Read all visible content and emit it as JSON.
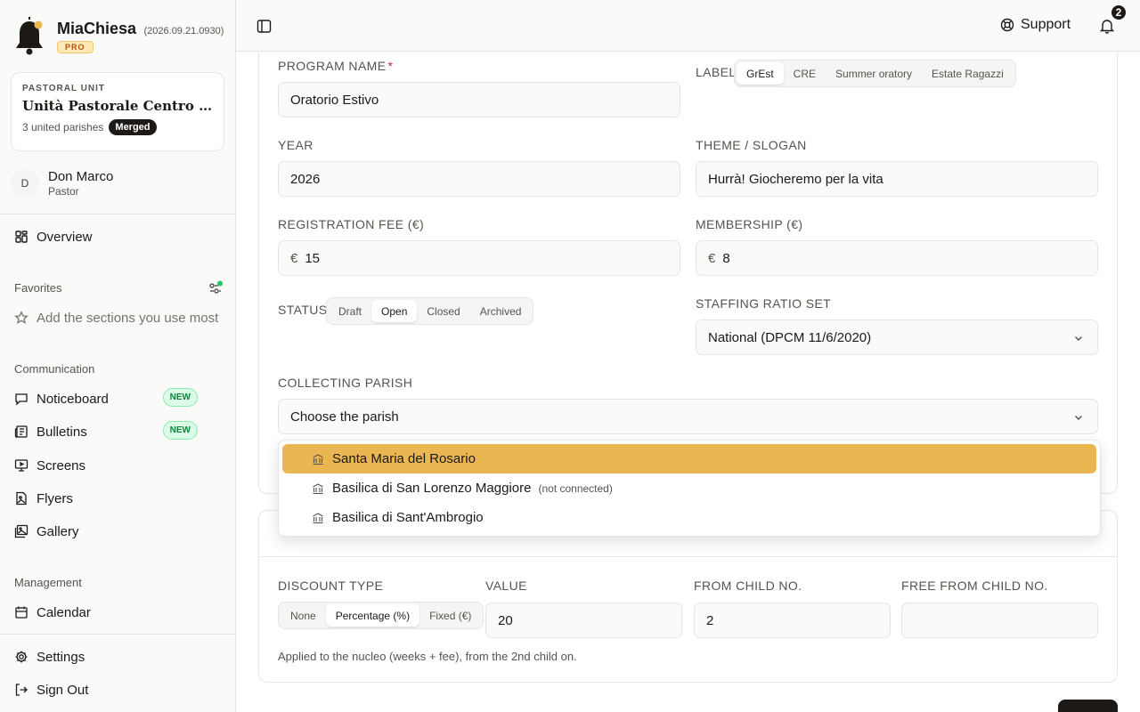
{
  "app": {
    "name": "MiaChiesa",
    "version": "(2026.09.21.0930)",
    "tier": "PRO"
  },
  "pastoral_unit": {
    "eyebrow": "PASTORAL UNIT",
    "name": "Unità Pastorale Centro Storico",
    "meta": "3 united parishes",
    "badge": "Merged"
  },
  "user": {
    "initial": "D",
    "name": "Don Marco",
    "role": "Pastor"
  },
  "nav": {
    "overview": "Overview",
    "favorites_title": "Favorites",
    "favorites_hint": "Add the sections you use most",
    "communication_title": "Communication",
    "noticeboard": "Noticeboard",
    "bulletins": "Bulletins",
    "screens": "Screens",
    "flyers": "Flyers",
    "gallery": "Gallery",
    "new_badge": "NEW",
    "management_title": "Management",
    "calendar": "Calendar",
    "settings": "Settings",
    "sign_out": "Sign Out"
  },
  "topbar": {
    "support": "Support",
    "notifications_count": "2"
  },
  "form": {
    "program_name_label": "PROGRAM NAME",
    "program_name_required": "*",
    "program_name_value": "Oratorio Estivo",
    "label_label": "LABEL",
    "label_options": [
      "GrEst",
      "CRE",
      "Summer oratory",
      "Estate Ragazzi"
    ],
    "label_selected": "GrEst",
    "year_label": "YEAR",
    "year_value": "2026",
    "theme_label": "THEME / SLOGAN",
    "theme_value": "Hurrà! Giocheremo per la vita",
    "fee_label": "REGISTRATION FEE (€)",
    "fee_prefix": "€",
    "fee_value": "15",
    "membership_label": "MEMBERSHIP (€)",
    "membership_prefix": "€",
    "membership_value": "8",
    "status_label": "STATUS",
    "status_options": [
      "Draft",
      "Open",
      "Closed",
      "Archived"
    ],
    "status_selected": "Open",
    "staffing_label": "STAFFING RATIO SET",
    "staffing_value": "National (DPCM 11/6/2020)",
    "collecting_label": "COLLECTING PARISH",
    "collecting_placeholder": "Choose the parish",
    "parish_options": [
      {
        "name": "Santa Maria del Rosario",
        "note": ""
      },
      {
        "name": "Basilica di San Lorenzo Maggiore",
        "note": "(not connected)"
      },
      {
        "name": "Basilica di Sant'Ambrogio",
        "note": ""
      }
    ]
  },
  "discount": {
    "type_label": "DISCOUNT TYPE",
    "type_options": [
      "None",
      "Percentage (%)",
      "Fixed (€)"
    ],
    "type_selected": "Percentage (%)",
    "value_label": "VALUE",
    "value": "20",
    "from_child_label": "FROM CHILD NO.",
    "from_child_value": "2",
    "free_from_label": "FREE FROM CHILD NO.",
    "free_from_value": "",
    "helper": "Applied to the nucleo (weeks + fee), from the 2nd child on."
  },
  "colors": {
    "accent": "#eab652",
    "ink": "#1c1917",
    "new_badge_bg": "#dcfce7",
    "new_badge_text": "#15803d",
    "favorites_dot": "#22c55e",
    "required": "#dc2626"
  }
}
